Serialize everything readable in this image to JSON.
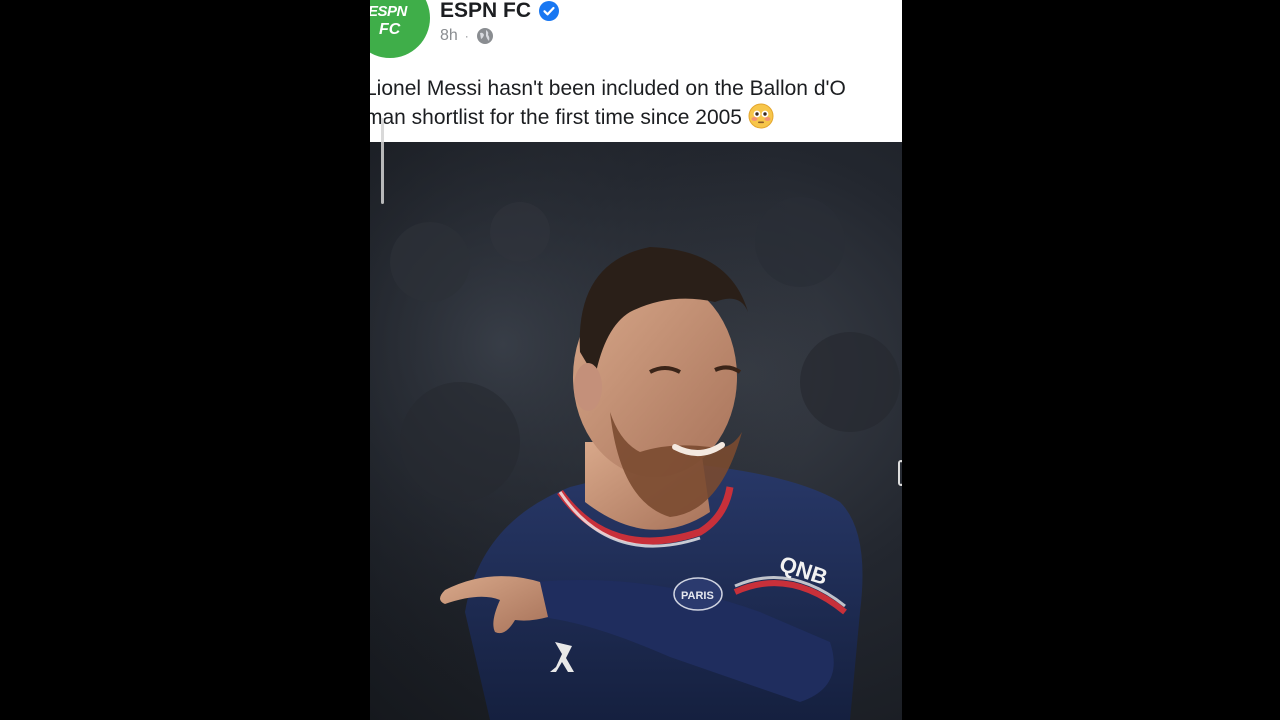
{
  "post": {
    "page_name": "ESPN FC",
    "verified_icon": "verified-badge-icon",
    "time": "8h",
    "separator": "·",
    "audience_icon": "globe-icon",
    "avatar": {
      "brand_top": "ESPN",
      "brand_bottom": "FC",
      "color": "#3fae49"
    },
    "text_line_1": "Lionel Messi hasn't been included on the Ballon d'O",
    "text_line_2": "man shortlist for the first time since 2005",
    "emoji": "flushed-face-emoji"
  },
  "photo": {
    "subject": "football-player-photo",
    "jersey_sponsor": "QNB",
    "jersey_crest": "PARIS",
    "colors": {
      "jersey": "#1f2d5e",
      "stripe": "#c8303a",
      "background": "#23272f"
    }
  },
  "colors": {
    "verified": "#1877f2",
    "text": "#1c1e21",
    "meta": "#8a8d91"
  }
}
